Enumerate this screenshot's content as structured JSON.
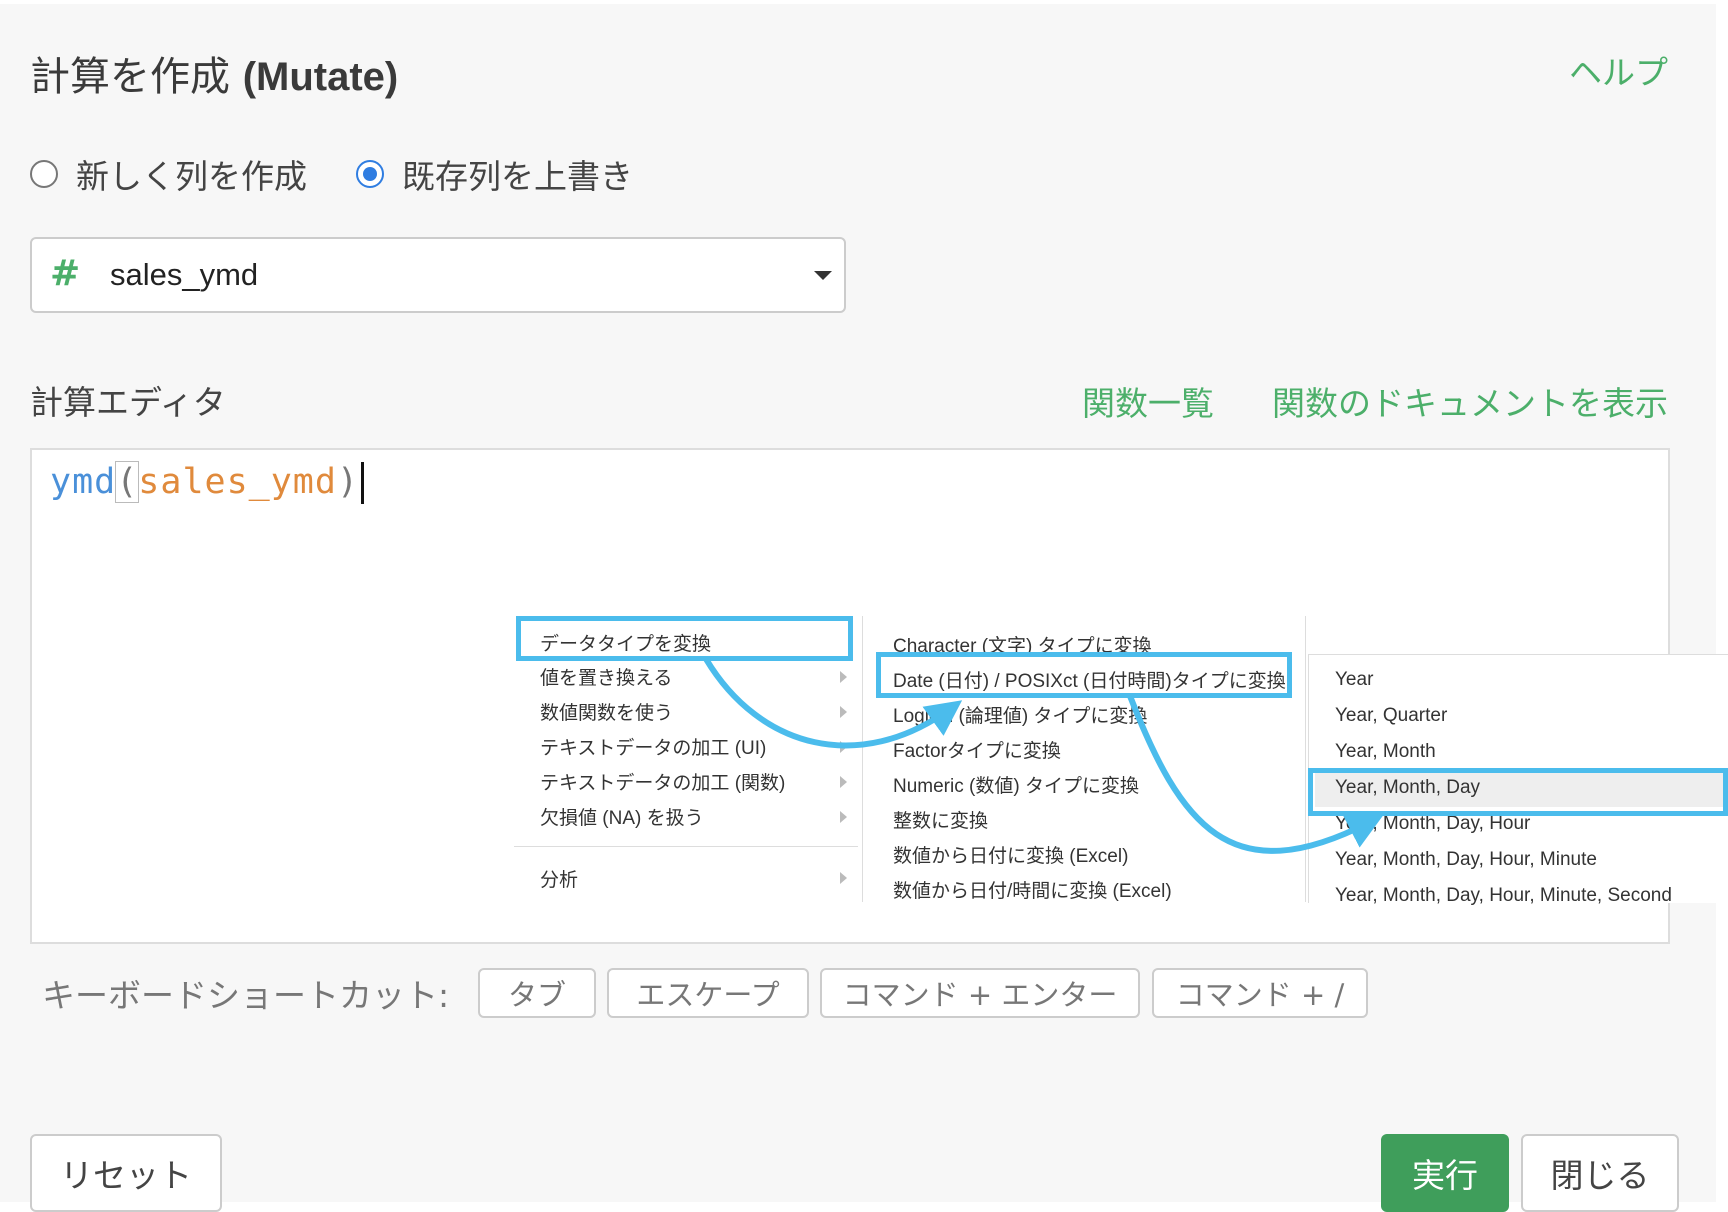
{
  "dialog": {
    "title_ja": "計算を作成 ",
    "title_en": "(Mutate)",
    "help": "ヘルプ"
  },
  "mode": {
    "options": [
      {
        "label": "新しく列を作成",
        "selected": false
      },
      {
        "label": "既存列を上書き",
        "selected": true
      }
    ]
  },
  "column_select": {
    "type_icon": "#",
    "value": "sales_ymd"
  },
  "editor": {
    "label": "計算エディタ",
    "function_list": "関数一覧",
    "function_docs": "関数のドキュメントを表示",
    "code": {
      "function": "ymd",
      "open_paren": "(",
      "argument": "sales_ymd",
      "close_paren": ")"
    }
  },
  "context_menu": {
    "level1": [
      "データタイプを変換",
      "値を置き換える",
      "数値関数を使う",
      "テキストデータの加工 (UI)",
      "テキストデータの加工 (関数)",
      "欠損値 (NA) を扱う",
      "分析"
    ],
    "level2": [
      "Character (文字) タイプに変換",
      "Date (日付) / POSIXct (日付時間)タイプに変換",
      "Logical (論理値) タイプに変換",
      "Factorタイプに変換",
      "Numeric (数値) タイプに変換",
      "整数に変換",
      "数値から日付に変換 (Excel)",
      "数値から日付/時間に変換 (Excel)"
    ],
    "level3": [
      "Year",
      "Year, Quarter",
      "Year, Month",
      "Year, Month, Day",
      "Year, Month, Day, Hour",
      "Year, Month, Day, Hour, Minute",
      "Year, Month, Day, Hour, Minute, Second"
    ],
    "highlight_color": "#4bbcec"
  },
  "shortcuts": {
    "label": "キーボードショートカット:",
    "keys": [
      "タブ",
      "エスケープ",
      "コマンド + エンター",
      "コマンド + /"
    ]
  },
  "footer": {
    "reset": "リセット",
    "run": "実行",
    "close": "閉じる"
  },
  "colors": {
    "accent_green": "#4caf6a",
    "run_button": "#3f9e5b",
    "radio_blue": "#2f7de1",
    "code_function": "#4a90d9",
    "code_argument": "#e08a3c"
  }
}
